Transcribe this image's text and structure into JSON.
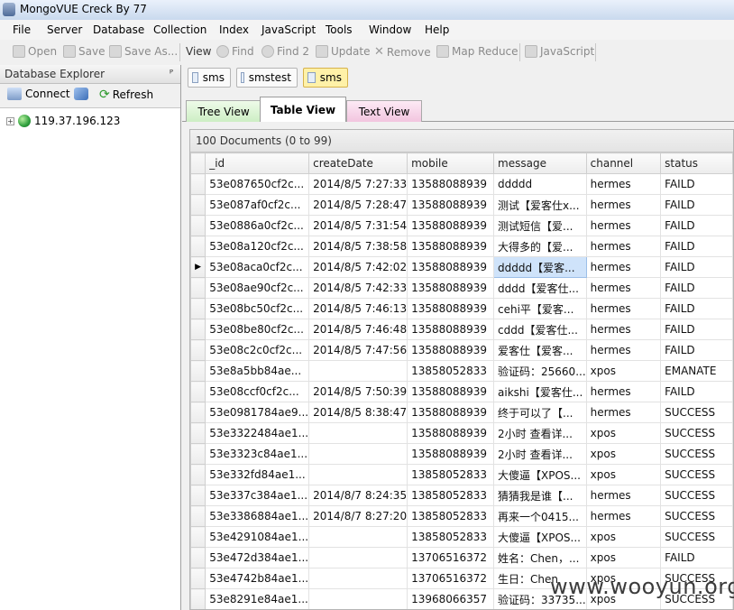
{
  "window": {
    "title": "MongoVUE Creck By 77"
  },
  "menu": [
    "File",
    "Server",
    "Database",
    "Collection",
    "Index",
    "JavaScript",
    "Tools",
    "Window",
    "Help"
  ],
  "toolbar": {
    "open": "Open",
    "save": "Save",
    "save_as": "Save As...",
    "view": "View",
    "find": "Find",
    "find2": "Find 2",
    "update": "Update",
    "remove": "Remove",
    "map_reduce": "Map Reduce",
    "javascript": "JavaScript"
  },
  "explorer": {
    "title": "Database Explorer",
    "pin": "ᵖ",
    "connect": "Connect",
    "refresh": "Refresh",
    "server": "119.37.196.123"
  },
  "collection_tabs": [
    "sms",
    "smstest",
    "sms"
  ],
  "view_tabs": [
    "Tree View",
    "Table View",
    "Text View"
  ],
  "grid": {
    "caption": "100 Documents (0 to 99)",
    "columns": [
      "_id",
      "createDate",
      "mobile",
      "message",
      "channel",
      "status"
    ],
    "rows": [
      [
        "53e087650cf2c...",
        "2014/8/5 7:27:33",
        "13588088939",
        "ddddd",
        "hermes",
        "FAILD"
      ],
      [
        "53e087af0cf2c...",
        "2014/8/5 7:28:47",
        "13588088939",
        "测试【爱客仕x...",
        "hermes",
        "FAILD"
      ],
      [
        "53e0886a0cf2c...",
        "2014/8/5 7:31:54",
        "13588088939",
        "测试短信【爱...",
        "hermes",
        "FAILD"
      ],
      [
        "53e08a120cf2c...",
        "2014/8/5 7:38:58",
        "13588088939",
        "大得多的【爱...",
        "hermes",
        "FAILD"
      ],
      [
        "53e08aca0cf2c...",
        "2014/8/5 7:42:02",
        "13588088939",
        "ddddd【爱客...",
        "hermes",
        "FAILD"
      ],
      [
        "53e08ae90cf2c...",
        "2014/8/5 7:42:33",
        "13588088939",
        "dddd【爱客仕...",
        "hermes",
        "FAILD"
      ],
      [
        "53e08bc50cf2c...",
        "2014/8/5 7:46:13",
        "13588088939",
        "cehi平【爱客...",
        "hermes",
        "FAILD"
      ],
      [
        "53e08be80cf2c...",
        "2014/8/5 7:46:48",
        "13588088939",
        "cddd【爱客仕...",
        "hermes",
        "FAILD"
      ],
      [
        "53e08c2c0cf2c...",
        "2014/8/5 7:47:56",
        "13588088939",
        "爱客仕【爱客...",
        "hermes",
        "FAILD"
      ],
      [
        "53e8a5bb84ae...",
        "",
        "13858052833",
        "验证码：25660...",
        "xpos",
        "EMANATE"
      ],
      [
        "53e08ccf0cf2c...",
        "2014/8/5 7:50:39",
        "13588088939",
        "aikshi【爱客仕...",
        "hermes",
        "FAILD"
      ],
      [
        "53e0981784ae9...",
        "2014/8/5 8:38:47",
        "13588088939",
        "终于可以了【...",
        "hermes",
        "SUCCESS"
      ],
      [
        "53e3322484ae1...",
        "",
        "13588088939",
        "2小时 查看详...",
        "xpos",
        "SUCCESS"
      ],
      [
        "53e3323c84ae1...",
        "",
        "13588088939",
        "2小时 查看详...",
        "xpos",
        "SUCCESS"
      ],
      [
        "53e332fd84ae1...",
        "",
        "13858052833",
        "大傻逼【XPOS...",
        "xpos",
        "SUCCESS"
      ],
      [
        "53e337c384ae1...",
        "2014/8/7 8:24:35",
        "13858052833",
        "猜猜我是谁【...",
        "hermes",
        "SUCCESS"
      ],
      [
        "53e3386884ae1...",
        "2014/8/7 8:27:20",
        "13858052833",
        "再来一个0415...",
        "hermes",
        "SUCCESS"
      ],
      [
        "53e4291084ae1...",
        "",
        "13858052833",
        "大傻逼【XPOS...",
        "xpos",
        "SUCCESS"
      ],
      [
        "53e472d384ae1...",
        "",
        "13706516372",
        "姓名：Chen，...",
        "xpos",
        "FAILD"
      ],
      [
        "53e4742b84ae1...",
        "",
        "13706516372",
        "生日：Chen",
        "xpos",
        "SUCCESS"
      ],
      [
        "53e8291e84ae1...",
        "",
        "13968066357",
        "验证码：33735...",
        "xpos",
        "SUCCESS"
      ]
    ],
    "current_row_marker": "▶"
  },
  "watermark": "www.wooyun.org"
}
